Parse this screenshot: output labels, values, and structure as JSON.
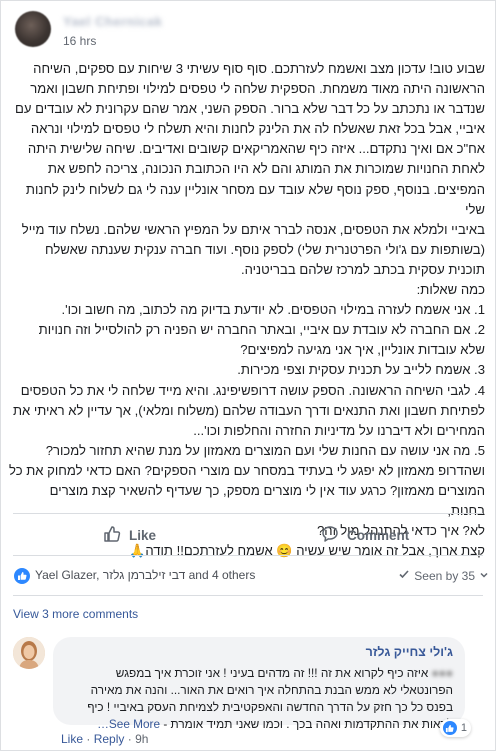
{
  "header": {
    "author": "Yael Chernicak",
    "time": "16 hrs"
  },
  "post": {
    "lines": [
      "שבוע טוב! עדכון מצב ואשמח לעזרתכם. סוף סוף עשיתי 3 שיחות עם ספקים, השיחה",
      "הראשונה היתה מאוד משמחת. הספקית שלחה לי טפסים למילוי ופתיחת חשבון ואמר",
      "שנדבר או נתכתב על כל דבר שלא ברור. הספק השני, אמר שהם עקרונית לא עובדים עם",
      "איביי, אבל בכל זאת שאשלח לה את הלינק לחנות והיא תשלח לי טפסים למילוי ונראה",
      "אח\"כ אם ואיך נתקדם... איזה כיף שהאמריקאים קשובים ואדיבים. שיחה שלישית היתה",
      "לאחת החנויות שמוכרות את המותג והם לא היו הכתובת הנכונה, צריכה לחפש את",
      "המפיצים. בנוסף, ספק נוסף שלא עובד עם מסחר אונליין ענה לי גם לשלוח לינק לחנות שלי",
      "באיביי ולמלא את הטפסים, אנסה לברר איתם על המפיץ הראשי שלהם. נשלח עוד מייל",
      "(בשותפות עם ג'ולי הפרטנרית שלי) לספק נוסף. ועוד חברה ענקית שענתה שאשלח",
      "תוכנית עסקית בכתב למרכז שלהם בבריטניה.",
      "כמה שאלות:",
      "1. אני אשמח לעזרה במילוי הטפסים. לא יודעת בדיוק מה לכתוב, מה חשוב וכו'.",
      "2. אם החברה לא עובדת עם איביי, ובאתר החברה יש הפניה רק להולסייל וזה חנויות",
      "שלא עובדות אונליין, איך אני מגיעה למפיצים?",
      "3. אשמח ללייב על תכנית עסקית וצפי מכירות.",
      "4. לגבי השיחה הראשונה. הספק עושה דרופשיפינג. והיא מייד שלחה לי את כל הטפסים",
      "לפתיחת חשבון ואת התנאים ודרך העבודה שלהם (משלוח ומלאי), אך עדיין לא ראיתי את",
      "המחירים ולא דיברנו על מדיניות החזרה והחלפות וכו'...",
      "5. מה אני עושה עם החנות שלי ועם המוצרים מאמזון על מנת שהיא תחזור למכור?",
      "ושהדרופ מאמזון לא יפגע לי בעתיד במסחר עם מוצרי הספקים? האם כדאי למחוק את כל",
      "המוצרים מאמזון? כרגע עוד אין לי מוצרים מספק, כך שעדיף להשאיר קצת מוצרים בחנות,",
      "לא? איך כדאי להתנהל מול זה?",
      "קצת ארוך, אבל זה אומר שיש עשיה 😊 אשמח לעזרתכם!! תודה🙏"
    ]
  },
  "actions": {
    "like_label": "Like",
    "comment_label": "Comment"
  },
  "reactions": {
    "names_prefix": "Yael Glazer, דבי זילברמן גלזר",
    "names_suffix": " and 4 others",
    "seen_by": "Seen by 35"
  },
  "comments": {
    "view_more": "View 3 more comments",
    "author": "ג'ולי צחייק גלזר",
    "text_line1": "איזה כיף לקרוא את זה !!! זה מדהים בעיני ! אני זוכרת איך במפגש",
    "text_line2": "הפרונטאלי לא ממש הבנת בהתחלה איך רואים את האור... והנה את מאירה",
    "text_line3": "בפנס כל כך חזק על הדרך החדשה והאפקטיבית לצמיחת העסק באיביי ! כיף",
    "text_line4": "לראות את ההתקדמות ואהה בכך . וכמו שאני תמיד אומרת -",
    "see_more": "See More…",
    "reaction_count": "1",
    "like": "Like",
    "reply": "Reply",
    "time": "9h"
  },
  "colors": {
    "link": "#385898",
    "like_blue": "#2d88ff",
    "text": "#1c1e21",
    "muted": "#616770"
  }
}
